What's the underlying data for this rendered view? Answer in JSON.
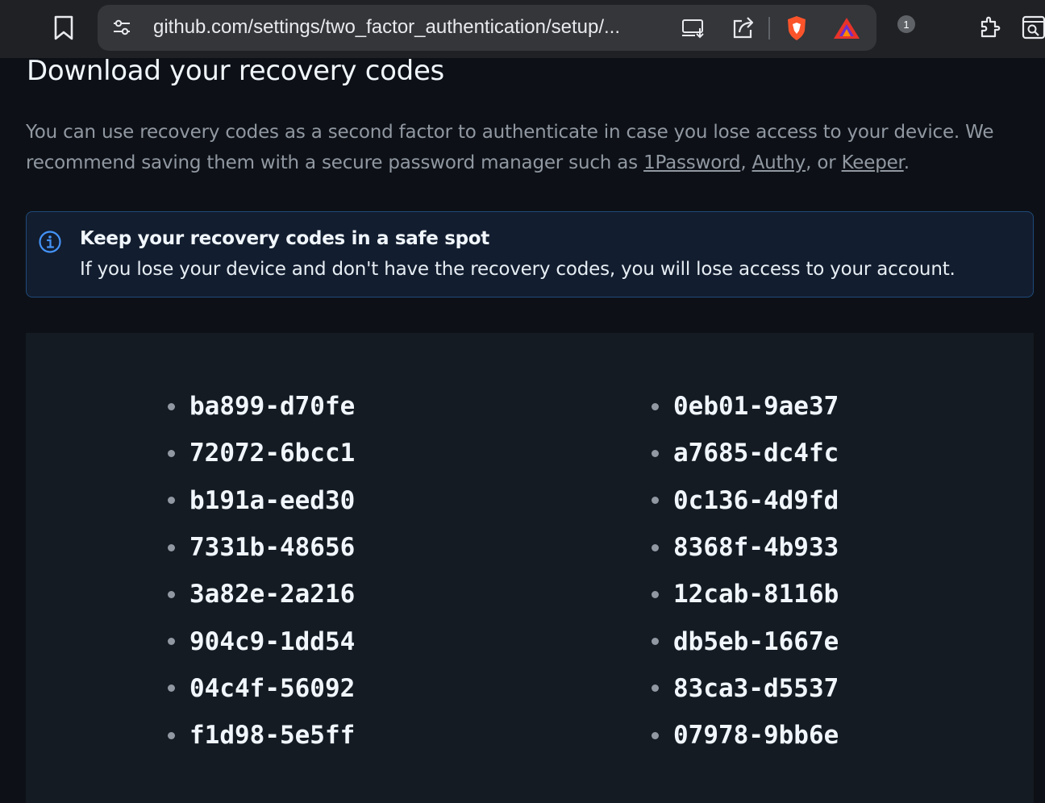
{
  "browser": {
    "url": "github.com/settings/two_factor_authentication/setup/...",
    "shields_count": "1"
  },
  "page": {
    "heading": "Download your recovery codes",
    "description_text": "You can use recovery codes as a second factor to authenticate in case you lose access to your device. We recommend saving them with a secure password manager such as ",
    "links": [
      "1Password",
      "Authy",
      "Keeper"
    ],
    "link_sep_1": ", ",
    "link_sep_2": ", or ",
    "link_end": ".",
    "flash": {
      "title": "Keep your recovery codes in a safe spot",
      "body": "If you lose your device and don't have the recovery codes, you will lose access to your account."
    },
    "codes_left": [
      "ba899-d70fe",
      "72072-6bcc1",
      "b191a-eed30",
      "7331b-48656",
      "3a82e-2a216",
      "904c9-1dd54",
      "04c4f-56092",
      "f1d98-5e5ff"
    ],
    "codes_right": [
      "0eb01-9ae37",
      "a7685-dc4fc",
      "0c136-4d9fd",
      "8368f-4b933",
      "12cab-8116b",
      "db5eb-1667e",
      "83ca3-d5537",
      "07978-9bb6e"
    ]
  },
  "colors": {
    "background": "#0d1117",
    "flash_bg": "#121d2f",
    "flash_border": "#1f4a7a",
    "accent_blue": "#4493f8",
    "muted_text": "#9198a1"
  }
}
